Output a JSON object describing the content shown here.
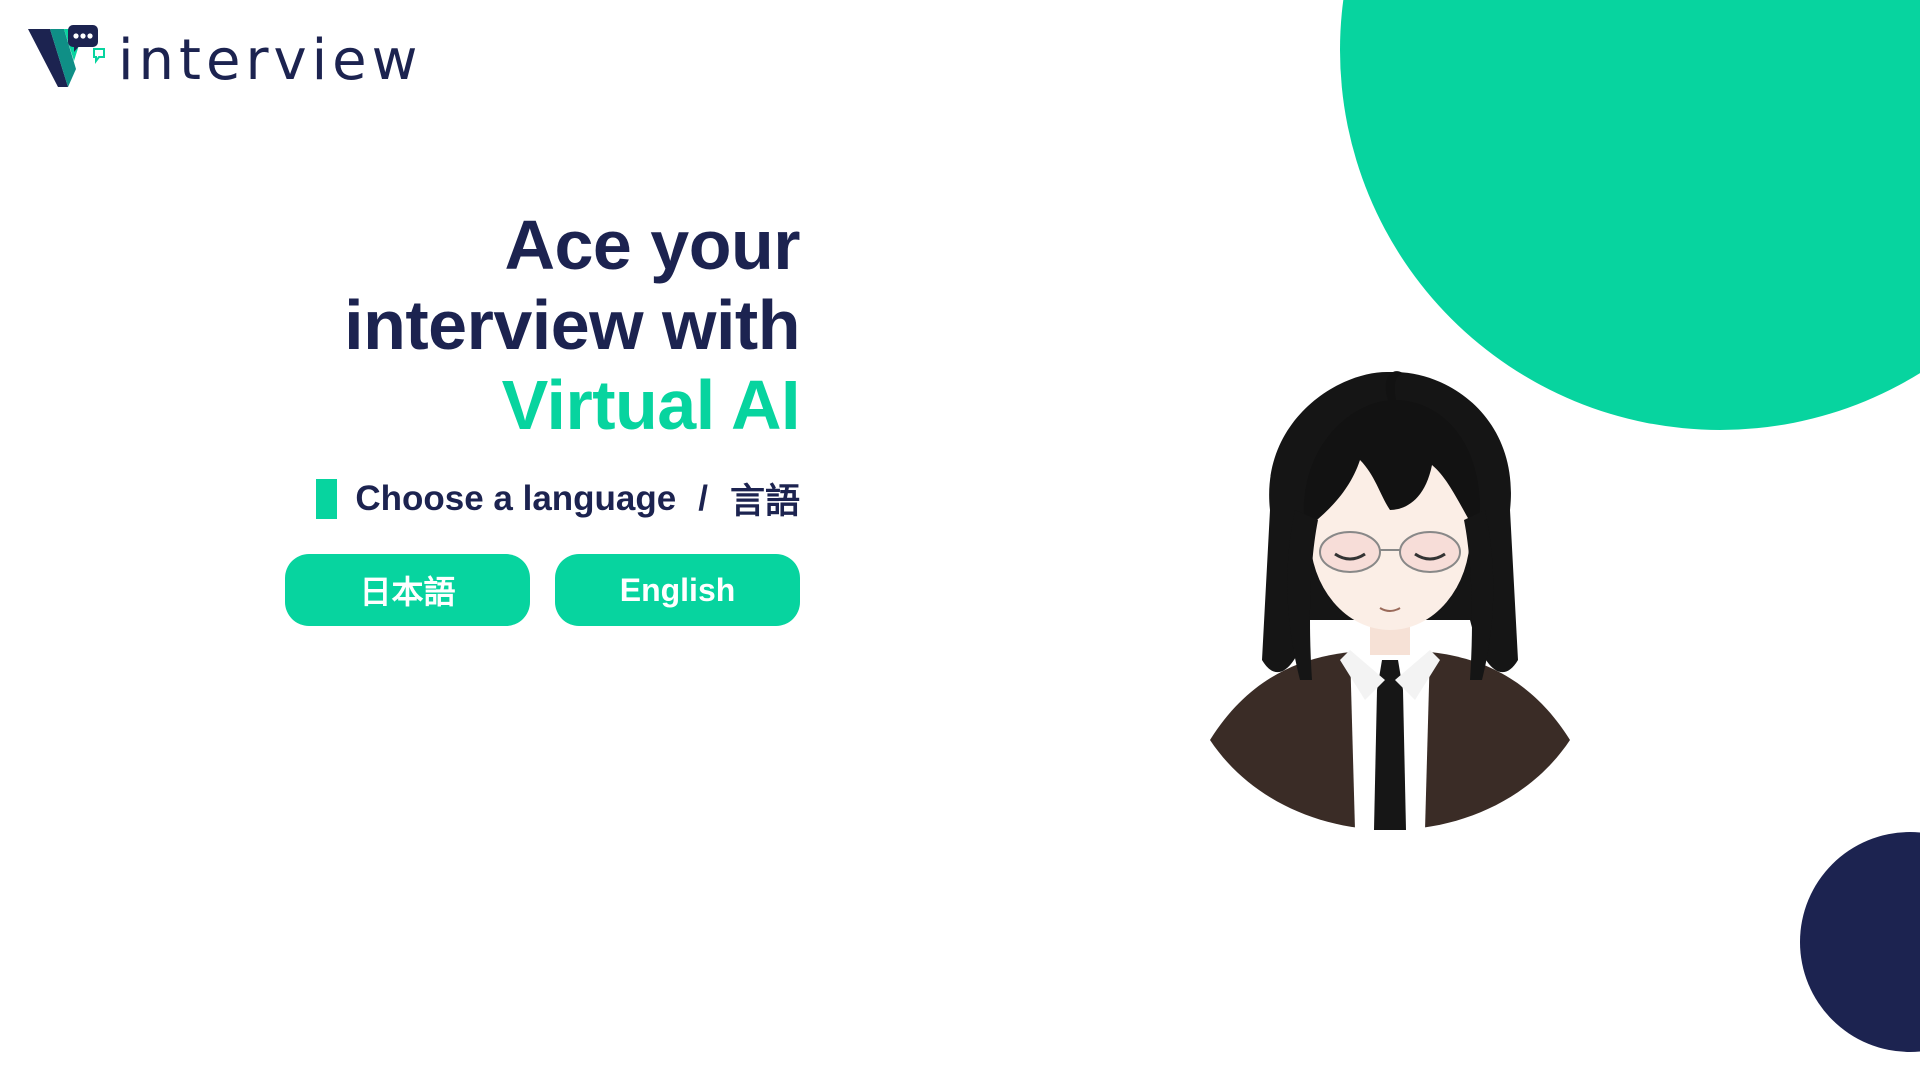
{
  "logo": {
    "text": "interview",
    "icon": "speech-bubble-v-logo"
  },
  "hero": {
    "line1": "Ace your",
    "line2": "interview with",
    "line3": "Virtual AI"
  },
  "language": {
    "prompt": "Choose a language",
    "separator": "/",
    "prompt_ja": "言語",
    "buttons": {
      "japanese": "日本語",
      "english": "English"
    }
  },
  "avatar": {
    "icon": "anime-avatar-character"
  },
  "colors": {
    "accent": "#07d49f",
    "navy": "#1c2350",
    "background": "#ffffff"
  }
}
